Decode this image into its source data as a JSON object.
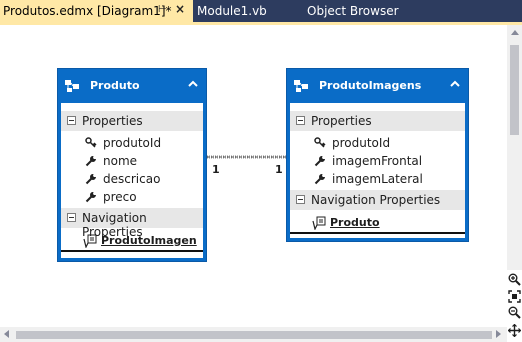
{
  "tabs": [
    {
      "label": "Produtos.edmx [Diagram1]*",
      "active": true
    },
    {
      "label": "Module1.vb",
      "active": false
    },
    {
      "label": "Object Browser",
      "active": false
    }
  ],
  "entities": [
    {
      "title": "Produto",
      "properties_label": "Properties",
      "properties": [
        {
          "name": "produtoId",
          "icon": "key-icon"
        },
        {
          "name": "nome",
          "icon": "wrench-icon"
        },
        {
          "name": "descricao",
          "icon": "wrench-icon"
        },
        {
          "name": "preco",
          "icon": "wrench-icon"
        }
      ],
      "navigation_label": "Navigation Properties",
      "navigation": [
        {
          "name": "ProdutoImagen",
          "icon": "navigation-property-icon"
        }
      ]
    },
    {
      "title": "ProdutoImagens",
      "properties_label": "Properties",
      "properties": [
        {
          "name": "produtoId",
          "icon": "key-icon"
        },
        {
          "name": "imagemFrontal",
          "icon": "wrench-icon"
        },
        {
          "name": "imagemLateral",
          "icon": "wrench-icon"
        }
      ],
      "navigation_label": "Navigation Properties",
      "navigation": [
        {
          "name": "Produto",
          "icon": "navigation-property-icon"
        }
      ]
    }
  ],
  "association": {
    "left_multiplicity": "1",
    "right_multiplicity": "1"
  },
  "colors": {
    "tabstrip_background": "#2d3c5f",
    "active_tab_background": "#ffe8a6",
    "entity_blue": "#0a6cc7",
    "section_gray": "#e7e7e7"
  },
  "zoom_tools": [
    "zoom-in-icon",
    "zoom-fit-icon",
    "zoom-out-icon",
    "pan-move-icon"
  ]
}
